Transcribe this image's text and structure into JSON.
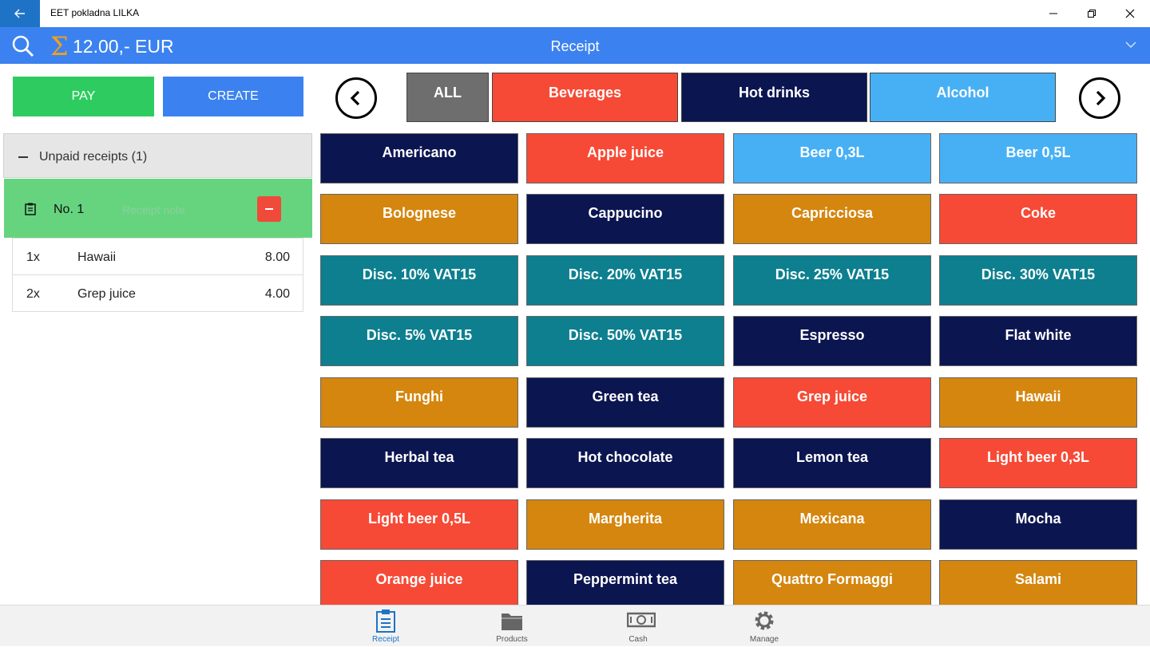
{
  "window": {
    "title": "EET pokladna LILKA"
  },
  "header": {
    "total": "12.00,- EUR",
    "title": "Receipt"
  },
  "actions": {
    "pay": "PAY",
    "create": "CREATE"
  },
  "receipts": {
    "group_label": "Unpaid receipts (1)",
    "current": {
      "number": "No. 1",
      "note_placeholder": "Receipt note"
    },
    "items": [
      {
        "qty": "1x",
        "name": "Hawaii",
        "price": "8.00"
      },
      {
        "qty": "2x",
        "name": "Grep juice",
        "price": "4.00"
      }
    ]
  },
  "categories": [
    {
      "label": "ALL",
      "color": "#6e6e6e"
    },
    {
      "label": "Beverages",
      "color": "#f64a36"
    },
    {
      "label": "Hot drinks",
      "color": "#0b1550"
    },
    {
      "label": "Alcohol",
      "color": "#47b0f5"
    }
  ],
  "products": [
    {
      "label": "Americano",
      "color": "navy"
    },
    {
      "label": "Apple juice",
      "color": "red"
    },
    {
      "label": "Beer 0,3L",
      "color": "sky"
    },
    {
      "label": "Beer 0,5L",
      "color": "sky"
    },
    {
      "label": "Bolognese",
      "color": "orange"
    },
    {
      "label": "Cappucino",
      "color": "navy"
    },
    {
      "label": "Capricciosa",
      "color": "orange"
    },
    {
      "label": "Coke",
      "color": "red"
    },
    {
      "label": "Disc. 10% VAT15",
      "color": "teal"
    },
    {
      "label": "Disc. 20% VAT15",
      "color": "teal"
    },
    {
      "label": "Disc. 25% VAT15",
      "color": "teal"
    },
    {
      "label": "Disc. 30% VAT15",
      "color": "teal"
    },
    {
      "label": "Disc. 5% VAT15",
      "color": "teal"
    },
    {
      "label": "Disc. 50% VAT15",
      "color": "teal"
    },
    {
      "label": "Espresso",
      "color": "navy"
    },
    {
      "label": "Flat white",
      "color": "navy"
    },
    {
      "label": "Funghi",
      "color": "orange"
    },
    {
      "label": "Green tea",
      "color": "navy"
    },
    {
      "label": "Grep juice",
      "color": "red"
    },
    {
      "label": "Hawaii",
      "color": "orange"
    },
    {
      "label": "Herbal tea",
      "color": "navy"
    },
    {
      "label": "Hot chocolate",
      "color": "navy"
    },
    {
      "label": "Lemon tea",
      "color": "navy"
    },
    {
      "label": "Light beer 0,3L",
      "color": "red"
    },
    {
      "label": "Light beer 0,5L",
      "color": "red"
    },
    {
      "label": "Margherita",
      "color": "orange"
    },
    {
      "label": "Mexicana",
      "color": "orange"
    },
    {
      "label": "Mocha",
      "color": "navy"
    },
    {
      "label": "Orange juice",
      "color": "red"
    },
    {
      "label": "Peppermint tea",
      "color": "navy"
    },
    {
      "label": "Quattro Formaggi",
      "color": "orange"
    },
    {
      "label": "Salami",
      "color": "orange"
    }
  ],
  "bottom_nav": [
    {
      "label": "Receipt",
      "icon": "clipboard-icon",
      "active": true
    },
    {
      "label": "Products",
      "icon": "folder-icon",
      "active": false
    },
    {
      "label": "Cash",
      "icon": "cash-icon",
      "active": false
    },
    {
      "label": "Manage",
      "icon": "gear-icon",
      "active": false
    }
  ]
}
